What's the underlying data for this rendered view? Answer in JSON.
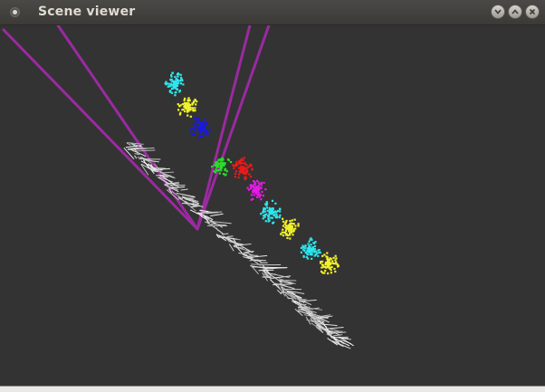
{
  "window": {
    "title": "Scene viewer",
    "controls": [
      "minimize",
      "maximize",
      "close"
    ],
    "menu_icon": "window-menu-icon"
  },
  "scene": {
    "background_color": "#333333",
    "ray_color": "#9a2aa0",
    "track_color": "#d0d0d0",
    "cluster_colors": [
      "cyan",
      "yellow",
      "blue",
      "green",
      "red",
      "magenta",
      "cyan",
      "yellow",
      "cyan",
      "yellow"
    ]
  }
}
